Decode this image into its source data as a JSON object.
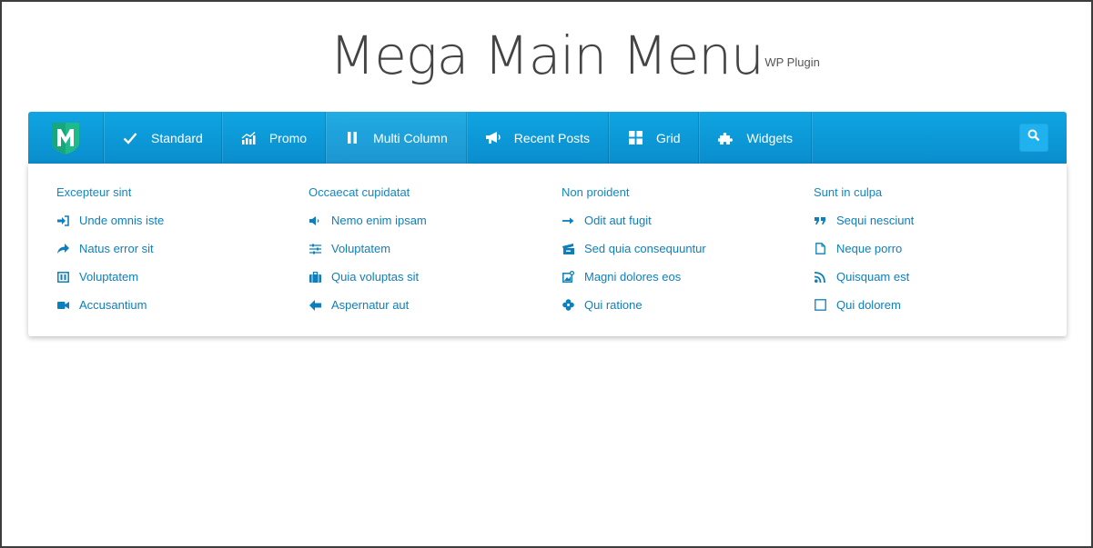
{
  "header": {
    "title": "Mega Main Menu",
    "badge": "WP Plugin"
  },
  "nav": {
    "items": [
      {
        "label": "Standard",
        "icon": "check-icon"
      },
      {
        "label": "Promo",
        "icon": "bar-chart-icon"
      },
      {
        "label": "Multi Column",
        "icon": "columns-icon",
        "active": true
      },
      {
        "label": "Recent Posts",
        "icon": "megaphone-icon"
      },
      {
        "label": "Grid",
        "icon": "grid-icon"
      },
      {
        "label": "Widgets",
        "icon": "puzzle-icon"
      }
    ],
    "search_icon": "search-icon",
    "logo_icon": "m-shield-logo-icon"
  },
  "dropdown": {
    "columns": [
      {
        "heading": "Excepteur sint",
        "links": [
          {
            "label": "Unde omnis iste",
            "icon": "sign-in-icon"
          },
          {
            "label": "Natus error sit",
            "icon": "share-arrow-icon"
          },
          {
            "label": "Voluptatem",
            "icon": "columns-box-icon"
          },
          {
            "label": "Accusantium",
            "icon": "video-camera-icon"
          }
        ]
      },
      {
        "heading": "Occaecat cupidatat",
        "links": [
          {
            "label": "Nemo enim ipsam",
            "icon": "volume-icon"
          },
          {
            "label": "Voluptatem",
            "icon": "sliders-icon"
          },
          {
            "label": "Quia voluptas sit",
            "icon": "briefcase-icon"
          },
          {
            "label": "Aspernatur aut",
            "icon": "arrow-left-icon"
          }
        ]
      },
      {
        "heading": "Non proident",
        "links": [
          {
            "label": "Odit aut fugit",
            "icon": "long-arrow-right-icon"
          },
          {
            "label": "Sed quia consequuntur",
            "icon": "ticket-icon"
          },
          {
            "label": "Magni dolores eos",
            "icon": "image-add-icon"
          },
          {
            "label": "Qui ratione",
            "icon": "flower-icon"
          }
        ]
      },
      {
        "heading": "Sunt in culpa",
        "links": [
          {
            "label": "Sequi nesciunt",
            "icon": "quote-icon"
          },
          {
            "label": "Neque porro",
            "icon": "file-icon"
          },
          {
            "label": "Quisquam est",
            "icon": "rss-icon"
          },
          {
            "label": "Qui dolorem",
            "icon": "checkbox-empty-icon"
          }
        ]
      }
    ]
  },
  "colors": {
    "nav_top": "#0fa5e2",
    "nav_bottom": "#0a8dcd",
    "link": "#0d7fbc",
    "logo_green": "#1fba8a"
  }
}
